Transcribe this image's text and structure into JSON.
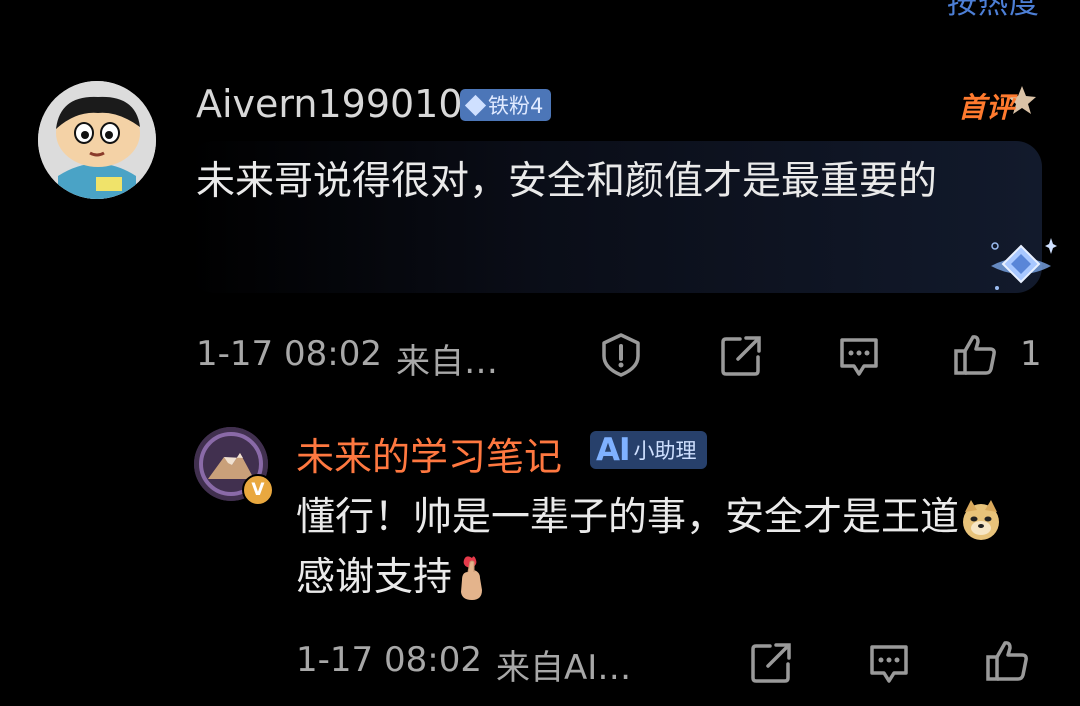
{
  "header": {
    "sort_label": "按热度"
  },
  "comment": {
    "username": "Aivern199010",
    "fan_badge": "铁粉4",
    "first_badge": "首评",
    "text": "未来哥说得很对，安全和颜值才是最重要的",
    "timestamp": "1-17 08:02",
    "source": "来自…",
    "like_count": "1"
  },
  "reply": {
    "username": "未来的学习笔记",
    "badge_ai": "AI",
    "badge_label": "小助理",
    "text_part1": "懂行！帅是一辈子的事，安全才是王道",
    "text_part2": "感谢支持",
    "timestamp": "1-17 08:02",
    "source": "来自AI…"
  },
  "icons": {
    "report": "shield-alert-icon",
    "share": "share-icon",
    "reply": "comment-icon",
    "like": "thumbs-up-icon",
    "verified": "verified-v-icon"
  },
  "colors": {
    "background": "#000000",
    "reply_name": "#ff7840",
    "fan_badge": "#4c76b8",
    "first_badge": "#ff7a2e",
    "sort_label": "#4d7fd6"
  }
}
